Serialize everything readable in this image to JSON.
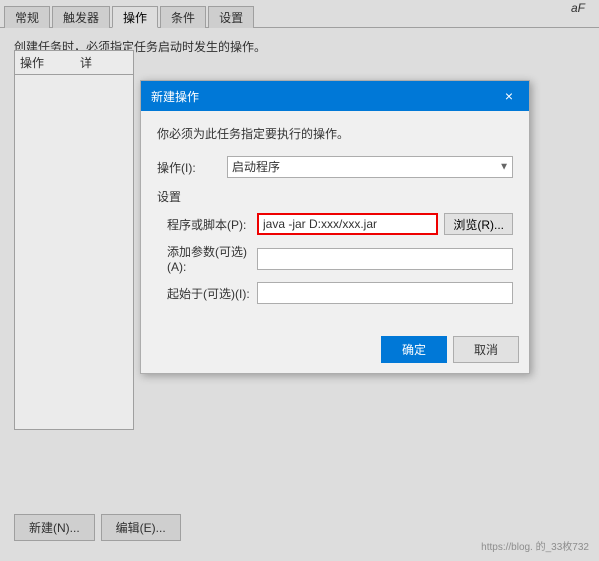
{
  "tabs": {
    "items": [
      {
        "label": "常规",
        "active": false
      },
      {
        "label": "触发器",
        "active": false
      },
      {
        "label": "操作",
        "active": true
      },
      {
        "label": "条件",
        "active": false
      },
      {
        "label": "设置",
        "active": false
      }
    ]
  },
  "main": {
    "description": "创建任务时，必须指定任务启动时发生的操作。",
    "left_panel_col1": "操作",
    "left_panel_col2": "详",
    "btn_new": "新建(N)...",
    "btn_edit": "编辑(E)..."
  },
  "modal": {
    "title": "新建操作",
    "close_label": "×",
    "description": "你必须为此任务指定要执行的操作。",
    "action_label": "操作(I):",
    "action_value": "启动程序",
    "settings_section": "设置",
    "program_label": "程序或脚本(P):",
    "program_value": "java -jar D:xxx/xxx.jar",
    "params_label": "添加参数(可选)(A):",
    "params_value": "",
    "start_label": "起始于(可选)(I):",
    "start_value": "",
    "browse_label": "浏览(R)...",
    "ok_label": "确定",
    "cancel_label": "取消"
  },
  "af_indicator": "aF",
  "url_watermark": "https://blog.          的_33枚732"
}
